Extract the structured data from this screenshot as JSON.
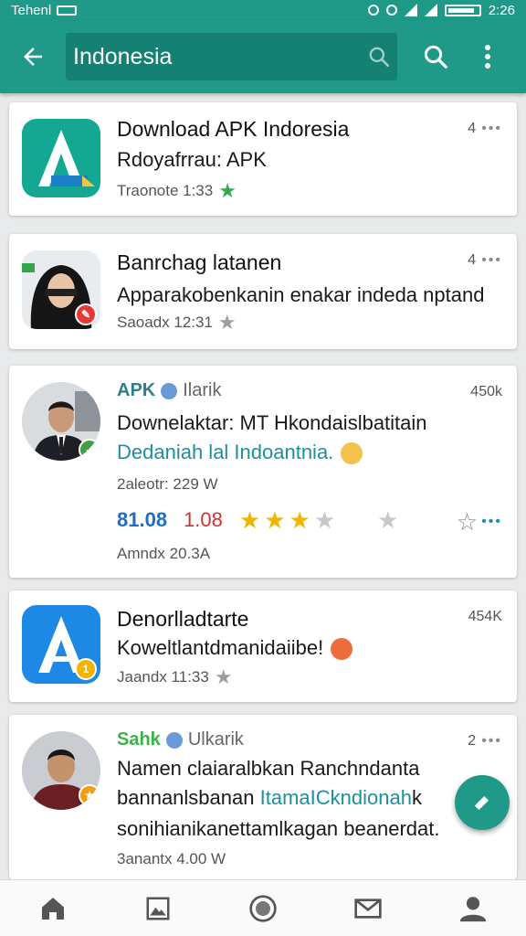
{
  "status_bar": {
    "carrier": "Tehenl",
    "time": "2:26"
  },
  "search": {
    "value": "Indonesia"
  },
  "colors": {
    "primary": "#1f9a88",
    "search_bg": "#148173",
    "star": "#f3b400",
    "link": "#1c8fa0"
  },
  "icons": [
    "back-arrow-icon",
    "search-icon",
    "more-vert-icon",
    "home-icon",
    "gallery-icon",
    "record-icon",
    "mail-icon",
    "profile-icon",
    "edit-icon"
  ],
  "feed": [
    {
      "title": "Download APK Indoresia",
      "line1": "Rdoyafrrau: APK",
      "meta": "Traonote 1:33",
      "count": "4"
    },
    {
      "title": "Banrchag latanen",
      "line1": "Apparakobenkanin enakar indeda nptand",
      "meta": "Saoadx 12:31",
      "count": "4"
    },
    {
      "name": "APK",
      "handle": "Ilarik",
      "count": "450k",
      "line1": "Downelaktar: MT Hkondaislbatitain",
      "line2": "Dedaniah lal Indoantnia.",
      "meta": "2aleotr: 229 W",
      "stat_blue": "81.08",
      "stat_red": "1.08",
      "rating": 3.5,
      "meta2": "Amndx 20.3A"
    },
    {
      "title": "Denorlladtarte",
      "line1": "Koweltlantdmanidaiibe!",
      "meta": "Jaandx 11:33",
      "count": "454K"
    },
    {
      "name": "Sahk",
      "handle": "Ulkarik",
      "count": "2",
      "line1": "Namen claiaralbkan Ranchndanta",
      "line2_a": "bannanlsbanan",
      "line2_b": "ItamaICkndionah",
      "line2_c": "k",
      "line3": "sonihianikanettamlkagan beanerdat.",
      "meta": "3anantx 4.00 W"
    }
  ]
}
